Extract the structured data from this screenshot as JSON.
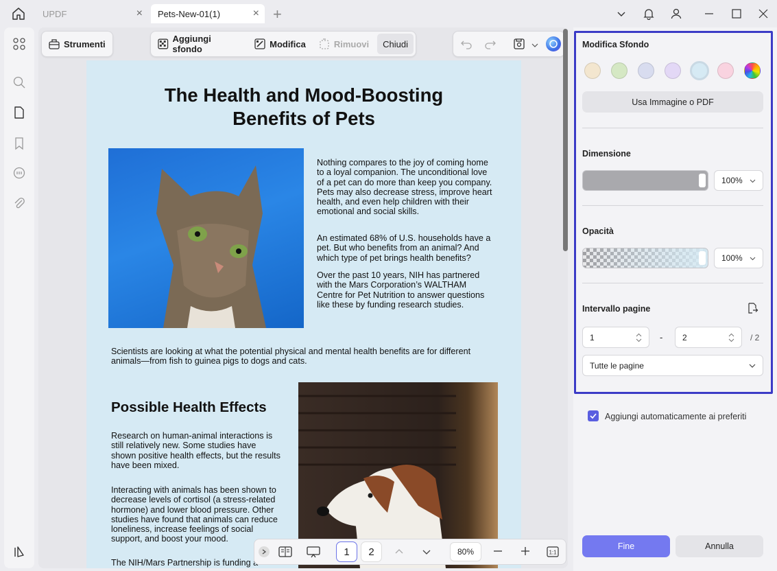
{
  "titlebar": {
    "tabs": [
      {
        "label": "UPDF"
      },
      {
        "label": "Pets-New-01(1)"
      }
    ]
  },
  "toolbar": {
    "tools_label": "Strumenti",
    "add_bg_label": "Aggiungi sfondo",
    "edit_label": "Modifica",
    "remove_label": "Rimuovi",
    "close_label": "Chiudi"
  },
  "document": {
    "title_line1": "The Health and Mood-Boosting",
    "title_line2": "Benefits of Pets",
    "para1": "Nothing compares to the joy of coming home to a loyal companion. The unconditional love of a pet can do more than keep you company. Pets may also decrease stress, improve heart health,  and  even  help children  with  their emotional and social skills.",
    "para2": "An estimated 68% of U.S. households have a pet. But who benefits from an animal? And which type of pet brings health benefits?",
    "para3": "Over  the  past  10  years,  NIH  has partnered with the Mars Corporation’s WALTHAM Centre for  Pet  Nutrition  to answer  questions  like these by funding research studies.",
    "para4": "Scientists are looking at what the potential physical and mental health benefits are for different animals—from fish to guinea pigs to dogs and cats.",
    "heading2": "Possible Health Effects",
    "para5": "Research  on  human-animal  interactions is still  relatively  new.  Some  studies  have shown  positive  health  effects,  but  the results have been mixed.",
    "para6": "Interacting with animals has been shown to decrease levels of cortisol (a stress-related hormone) and lower blood pressure. Other studies have found that animals can reduce loneliness,  increase  feelings  of social support, and boost your mood.",
    "para7": "The  NIH/Mars  Partnership  is  funding  a"
  },
  "panel": {
    "title": "Modifica Sfondo",
    "swatch_colors": [
      "#f3e6cf",
      "#d5e8c4",
      "#d8dcef",
      "#e3d8f6",
      "#d6eaf4",
      "#f9d3e0"
    ],
    "use_image_label": "Usa Immagine o PDF",
    "size_label": "Dimensione",
    "size_value": "100%",
    "size_level": 1.0,
    "opacity_label": "Opacità",
    "opacity_value": "100%",
    "opacity_level": 1.0,
    "range_label": "Intervallo pagine",
    "range_from": "1",
    "range_sep": "-",
    "range_to": "2",
    "range_total": "/ 2",
    "pages_select": "Tutte le pagine",
    "auto_fav_label": "Aggiungi automaticamente ai preferiti",
    "done_label": "Fine",
    "cancel_label": "Annulla"
  },
  "bottombar": {
    "page1": "1",
    "page2": "2",
    "zoom": "80%"
  }
}
